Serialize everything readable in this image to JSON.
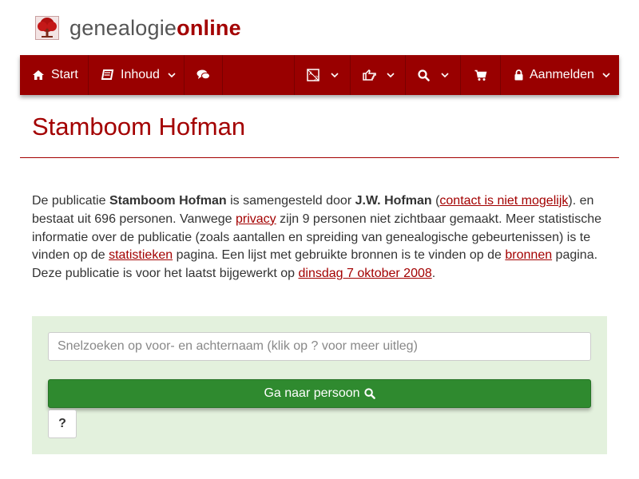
{
  "brand": {
    "part1": "genealogie",
    "part2": "online",
    "logo_icon": "tree-icon"
  },
  "nav": {
    "start": {
      "label": "Start",
      "icon": "home-icon"
    },
    "inhoud": {
      "label": "Inhoud",
      "icon": "book-icon"
    },
    "chat": {
      "icon": "comments-icon"
    },
    "language": {
      "icon": "translate-icon"
    },
    "share": {
      "icon": "hand-point-icon"
    },
    "search": {
      "icon": "search-icon"
    },
    "cart": {
      "icon": "cart-icon"
    },
    "login": {
      "label": "Aanmelden",
      "icon": "lock-icon"
    }
  },
  "page": {
    "title": "Stamboom Hofman"
  },
  "intro": {
    "t1": "De publicatie ",
    "pub_name": "Stamboom Hofman",
    "t2": " is samengesteld door ",
    "author": "J.W. Hofman",
    "t3": " (",
    "contact_link": "contact is niet mogelijk",
    "t4": "). en bestaat uit 696 personen. Vanwege ",
    "privacy_link": "privacy",
    "t5": " zijn 9 personen niet zichtbaar gemaakt. Meer statistische informatie over de publicatie (zoals aantallen en spreiding van genealogische gebeurtenissen) is te vinden op de ",
    "stats_link": "statistieken",
    "t6": " pagina. Een lijst met gebruikte bronnen is te vinden op de ",
    "sources_link": "bronnen",
    "t7": " pagina. Deze publicatie is voor het laatst bijgewerkt op ",
    "date_link": "dinsdag 7 oktober 2008",
    "t8": "."
  },
  "search": {
    "placeholder": "Snelzoeken op voor- en achternaam (klik op ? voor meer uitleg)",
    "go_label": "Ga naar persoon",
    "help_label": "?"
  },
  "colors": {
    "brand_red": "#990000",
    "link_red": "#a30000",
    "go_green": "#2f8a2f",
    "panel_green": "#e3f1dd"
  }
}
